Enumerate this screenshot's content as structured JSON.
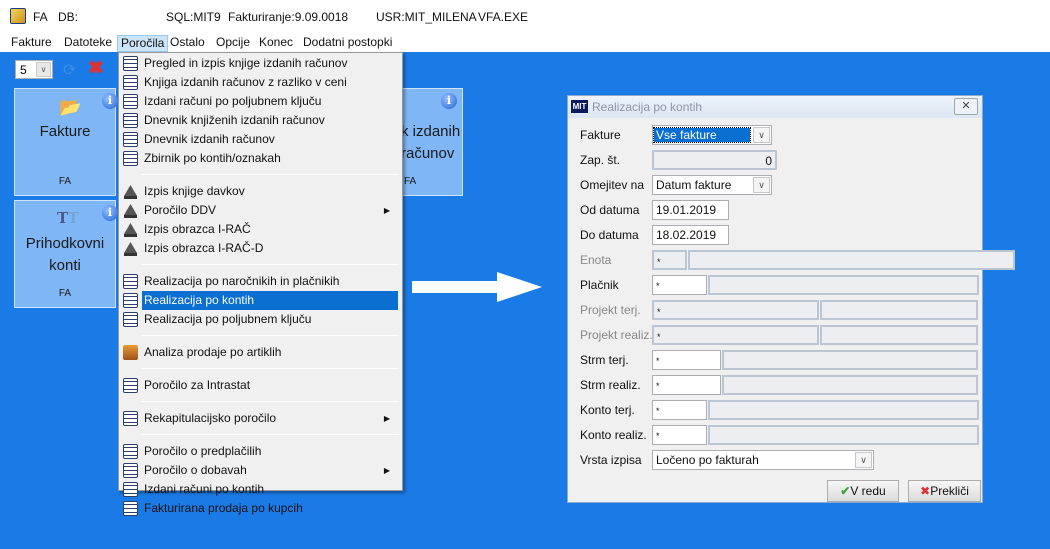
{
  "titlebar": {
    "app": "FA",
    "db": "DB:",
    "sql": "SQL:MIT9",
    "version": "Fakturiranje:9.09.0018",
    "user": "USR:MIT_MILENA",
    "exe": "VFA.EXE"
  },
  "menubar": [
    "Fakture",
    "Datoteke",
    "Poročila",
    "Ostalo",
    "Opcije",
    "Konec",
    "Dodatni postopki"
  ],
  "toolbar": {
    "count_value": "5"
  },
  "tiles": [
    {
      "title": "Fakture",
      "sub": "FA",
      "icon": "folder-open-icon"
    },
    {
      "title": "k izdanih računov",
      "sub": "FA",
      "icon": "list-icon"
    },
    {
      "title": "Prihodkovni konti",
      "sub": "FA",
      "icon": "tt-icon"
    }
  ],
  "menu": {
    "groups": [
      [
        {
          "label": "Pregled in izpis knjige izdanih računov",
          "icon": "list"
        },
        {
          "label": "Knjiga izdanih računov z razliko v ceni",
          "icon": "list"
        },
        {
          "label": "Izdani računi po poljubnem ključu",
          "icon": "list"
        },
        {
          "label": "Dnevnik knjiženih izdanih računov",
          "icon": "list"
        },
        {
          "label": "Dnevnik izdanih računov",
          "icon": "list"
        },
        {
          "label": "Zbirnik po kontih/oznakah",
          "icon": "list"
        }
      ],
      [
        {
          "label": "Izpis knjige davkov",
          "icon": "durs"
        },
        {
          "label": "Poročilo DDV",
          "icon": "durs",
          "submenu": true
        },
        {
          "label": "Izpis obrazca I-RAČ",
          "icon": "durs"
        },
        {
          "label": "Izpis obrazca I-RAČ-D",
          "icon": "durs"
        }
      ],
      [
        {
          "label": "Realizacija po naročnikih in plačnikih",
          "icon": "list"
        },
        {
          "label": "Realizacija po kontih",
          "icon": "list",
          "highlighted": true
        },
        {
          "label": "Realizacija po poljubnem ključu",
          "icon": "list"
        }
      ],
      [
        {
          "label": "Analiza prodaje po artiklih",
          "icon": "box"
        }
      ],
      [
        {
          "label": "Poročilo za Intrastat",
          "icon": "list"
        }
      ],
      [
        {
          "label": "Rekapitulacijsko poročilo",
          "icon": "list",
          "submenu": true
        }
      ],
      [
        {
          "label": "Poročilo o predplačilih",
          "icon": "list"
        },
        {
          "label": "Poročilo o dobavah",
          "icon": "list",
          "submenu": true
        },
        {
          "label": "Izdani računi po kontih",
          "icon": "list"
        },
        {
          "label": "Fakturirana prodaja po kupcih",
          "icon": "list"
        }
      ]
    ]
  },
  "dialog": {
    "title": "Realizacija po kontih",
    "ok": "V redu",
    "cancel": "Prekliči",
    "rows": [
      {
        "label": "Fakture",
        "type": "combo",
        "value": "Vse fakture",
        "selected": true
      },
      {
        "label": "Zap. št.",
        "type": "num",
        "value": "0"
      },
      {
        "label": "Omejitev na",
        "type": "combo",
        "value": "Datum fakture"
      },
      {
        "label": "Od datuma",
        "type": "text",
        "value": "19.01.2019"
      },
      {
        "label": "Do datuma",
        "type": "text",
        "value": "18.02.2019"
      },
      {
        "label": "Enota",
        "type": "pair",
        "value": "*",
        "disabled": true
      },
      {
        "label": "Plačnik",
        "type": "pair",
        "value": "*"
      },
      {
        "label": "Projekt terj.",
        "type": "pair",
        "value": "*",
        "disabled": true
      },
      {
        "label": "Projekt realiz.",
        "type": "pair",
        "value": "*",
        "disabled": true
      },
      {
        "label": "Strm terj.",
        "type": "pair",
        "value": "*"
      },
      {
        "label": "Strm realiz.",
        "type": "pair",
        "value": "*"
      },
      {
        "label": "Konto terj.",
        "type": "pair",
        "value": "*"
      },
      {
        "label": "Konto realiz.",
        "type": "pair",
        "value": "*"
      },
      {
        "label": "Vrsta izpisa",
        "type": "combo",
        "value": "Ločeno po fakturah"
      }
    ]
  },
  "colors": {
    "desktop": "#1a7ae6",
    "tile": "#7fb6f6",
    "highlight": "#0a6fd1"
  }
}
